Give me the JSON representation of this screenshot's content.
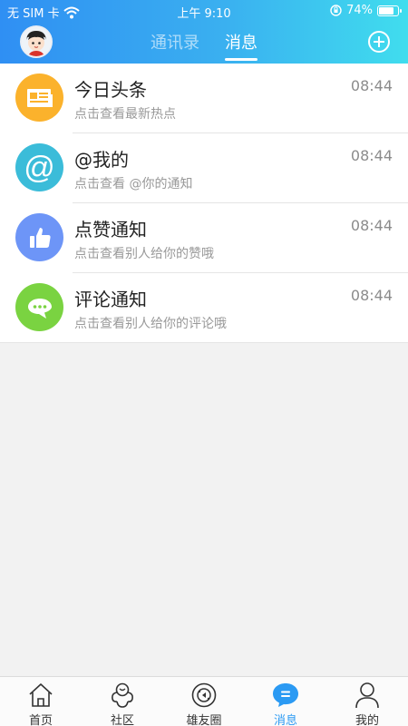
{
  "status_bar": {
    "carrier": "无 SIM 卡",
    "time": "上午 9:10",
    "battery": "74%",
    "battery_level": 0.74
  },
  "header": {
    "tabs": [
      {
        "label": "通讯录",
        "active": false
      },
      {
        "label": "消息",
        "active": true
      }
    ]
  },
  "messages": [
    {
      "title": "今日头条",
      "subtitle": "点击查看最新热点",
      "time": "08:44",
      "icon": "newspaper-icon",
      "color": "#fbb22c"
    },
    {
      "title": "@我的",
      "subtitle": "点击查看 @你的通知",
      "time": "08:44",
      "icon": "at-icon",
      "color": "#3bbcd9"
    },
    {
      "title": "点赞通知",
      "subtitle": "点击查看别人给你的赞哦",
      "time": "08:44",
      "icon": "thumbs-up-icon",
      "color": "#6d95f7"
    },
    {
      "title": "评论通知",
      "subtitle": "点击查看别人给你的评论哦",
      "time": "08:44",
      "icon": "comment-icon",
      "color": "#7ad341"
    }
  ],
  "tab_bar": {
    "items": [
      {
        "label": "首页",
        "icon": "home-icon",
        "active": false
      },
      {
        "label": "社区",
        "icon": "community-icon",
        "active": false
      },
      {
        "label": "雄友圈",
        "icon": "circle-icon",
        "active": false
      },
      {
        "label": "消息",
        "icon": "message-icon",
        "active": true
      },
      {
        "label": "我的",
        "icon": "user-icon",
        "active": false
      }
    ]
  },
  "colors": {
    "accent": "#2b9af3",
    "header_gradient_start": "#2f8ff3",
    "header_gradient_end": "#40ddee"
  }
}
